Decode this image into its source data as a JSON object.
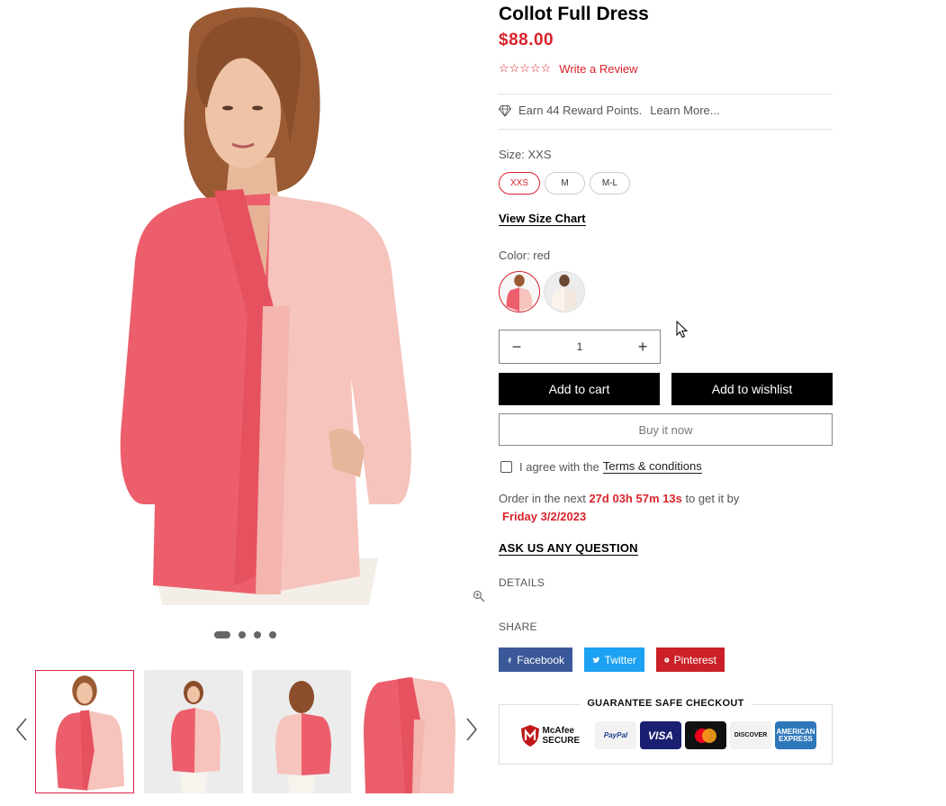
{
  "product": {
    "title": "Collot Full Dress",
    "price": "$88.00",
    "rating_stars": "☆☆☆☆☆",
    "review_link": "Write a Review",
    "rewards_text": "Earn 44 Reward Points.",
    "rewards_link": "Learn More...",
    "size_label": "Size: XXS",
    "sizes": [
      "XXS",
      "M",
      "M-L"
    ],
    "size_chart": "View Size Chart",
    "color_label": "Color: red",
    "quantity": "1",
    "add_to_cart": "Add to cart",
    "add_to_wishlist": "Add to wishlist",
    "buy_now": "Buy it now",
    "agree_text": "I agree with the",
    "terms_link": "Terms & conditions",
    "order_prefix": "Order in the next",
    "order_countdown": "27d 03h 57m 13s",
    "order_middle": "to get it by",
    "order_date": "Friday 3/2/2023",
    "ask_question": "ASK US ANY QUESTION",
    "details": "DETAILS",
    "share_label": "SHARE",
    "share": {
      "facebook": "Facebook",
      "twitter": "Twitter",
      "pinterest": "Pinterest"
    },
    "guarantee_title": "GUARANTEE SAFE CHECKOUT",
    "payments": {
      "mcafee": "McAfee SECURE",
      "paypal": "PayPal",
      "visa": "VISA",
      "discover": "DISCOVER",
      "amex": "AMERICAN EXPRESS"
    }
  },
  "colors": {
    "accent_red": "#d8232a",
    "facebook": "#3b5998",
    "twitter": "#1da1f2",
    "pinterest": "#cb2027"
  }
}
